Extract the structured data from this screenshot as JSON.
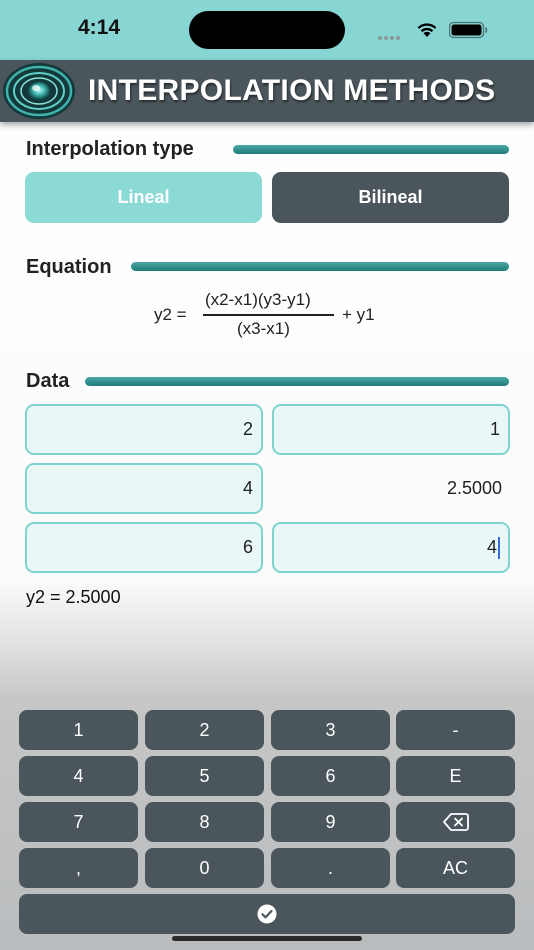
{
  "status_bar": {
    "time": "4:14"
  },
  "header": {
    "title": "INTERPOLATION METHODS"
  },
  "sections": {
    "interpolation_type": "Interpolation type",
    "equation": "Equation",
    "data": "Data"
  },
  "interpolation_type": {
    "options": [
      "Lineal",
      "Bilineal"
    ],
    "selected": "Lineal"
  },
  "equation": {
    "lhs": "y2 =",
    "numerator": "(x2-x1)(y3-y1)",
    "denominator": "(x3-x1)",
    "rhs": "+ y1"
  },
  "data": {
    "x1": "2",
    "y1": "1",
    "x2": "4",
    "y2": "2.5000",
    "x3": "6",
    "y3": "4"
  },
  "result": "y2 = 2.5000",
  "keypad": {
    "rows": [
      [
        "1",
        "2",
        "3",
        "-"
      ],
      [
        "4",
        "5",
        "6",
        "E"
      ],
      [
        "7",
        "8",
        "9",
        "backspace"
      ],
      [
        ",",
        "0",
        ".",
        "AC"
      ]
    ],
    "done_icon": "checkmark-circle-icon"
  },
  "colors": {
    "accent": "#87d6d3",
    "dark": "#4b565c",
    "field_bg": "#e9f8f7",
    "field_border": "#7ed3cf",
    "bar": "#1e7c79"
  }
}
